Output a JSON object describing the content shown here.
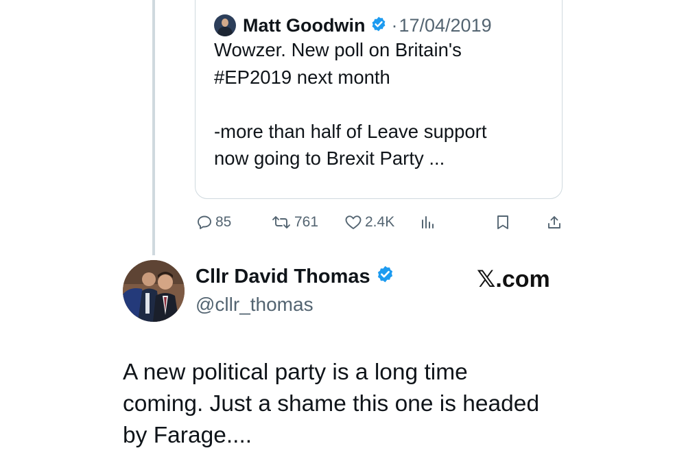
{
  "quoted_tweet": {
    "author_name": "Matt Goodwin",
    "separator": "·",
    "date": "17/04/2019",
    "lines": [
      "Wowzer. New poll on Britain's",
      "#EP2019 next month",
      "",
      "-more than half of Leave support",
      "now going to Brexit Party ..."
    ]
  },
  "actions": {
    "replies": "85",
    "reposts": "761",
    "likes": "2.4K"
  },
  "post": {
    "author_name": "Cllr David Thomas",
    "handle": "@cllr_thomas",
    "text_lines": [
      "A new political party is a long time",
      "coming. Just a shame this one is headed",
      "by Farage...."
    ]
  },
  "watermark": {
    "x_glyph": "𝕏",
    "suffix": ".com"
  },
  "colors": {
    "verified": "#1d9bf0",
    "muted": "#536471",
    "border": "#cfd9de"
  }
}
